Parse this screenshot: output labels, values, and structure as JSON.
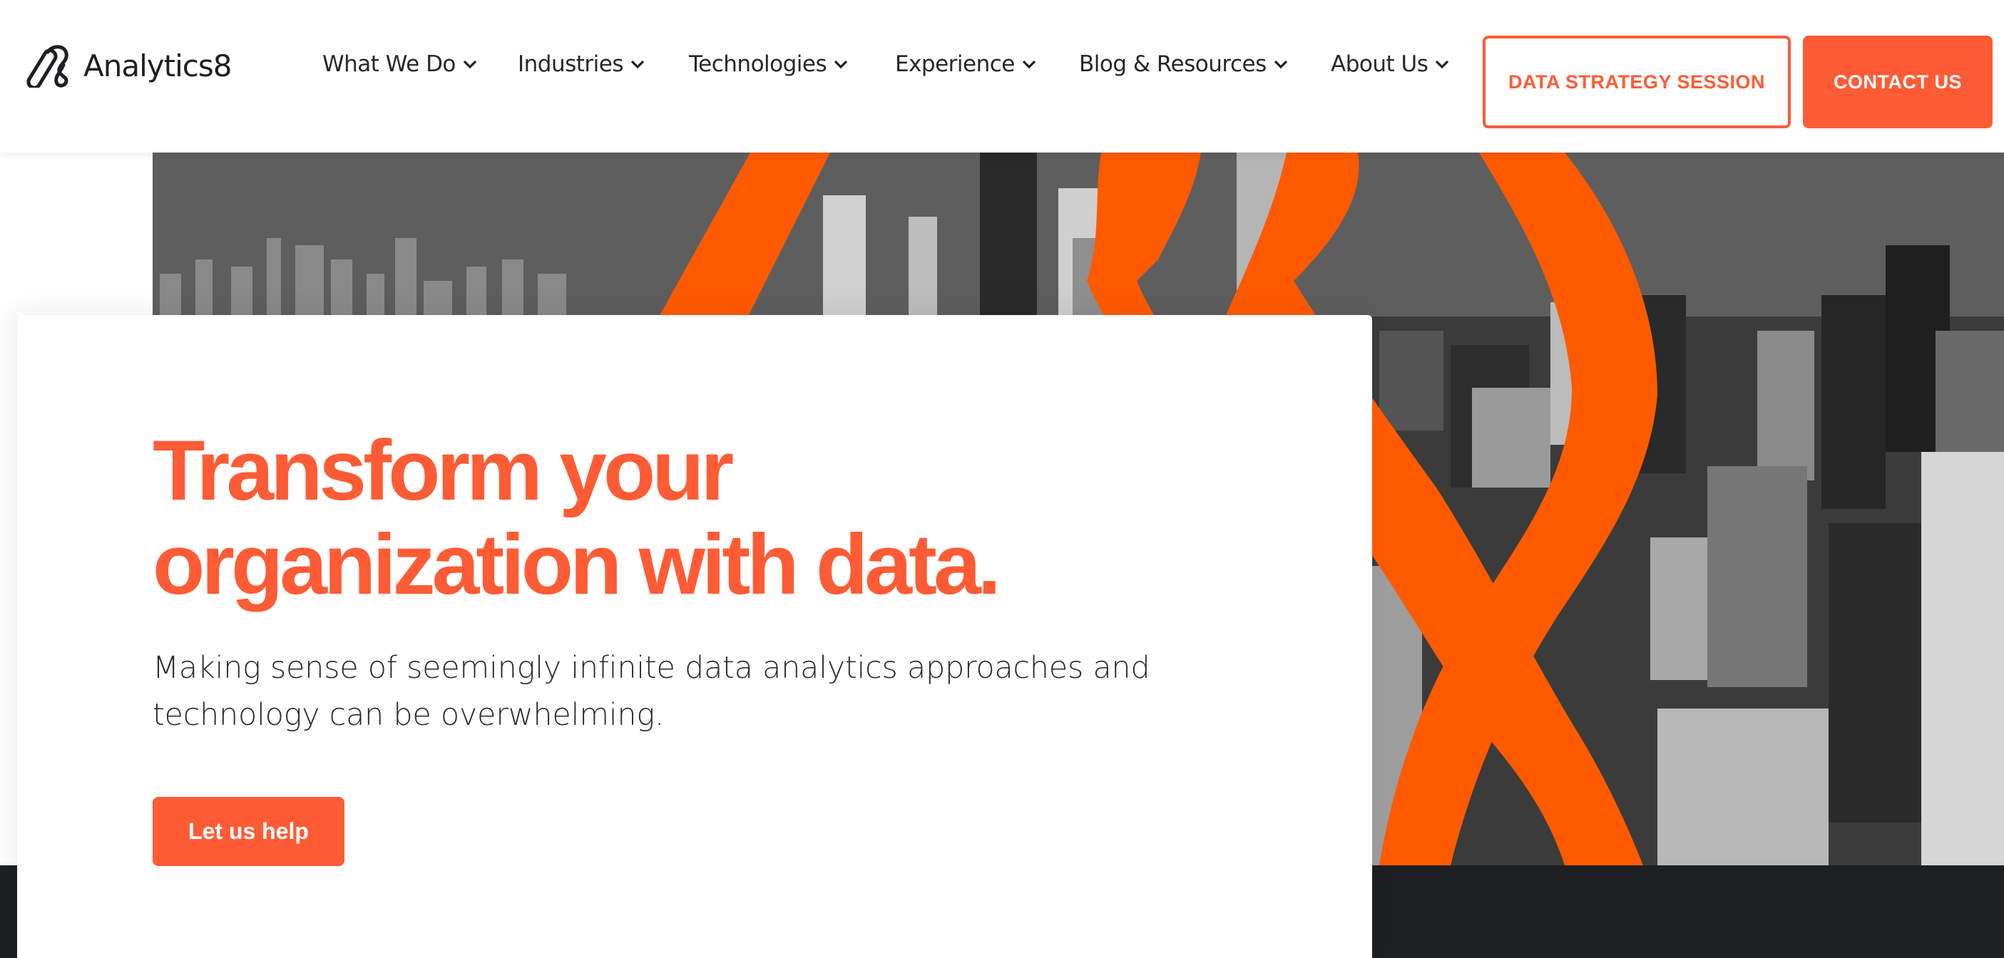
{
  "brand": {
    "name": "Analytics8",
    "logo_icon": "analytics8-logo-icon",
    "accent_color": "#ff5b35",
    "graphic_orange": "#ff5a00",
    "dark_color": "#1e1f23"
  },
  "nav": {
    "items": [
      {
        "label": "What We Do",
        "icon": "chevron-down-icon"
      },
      {
        "label": "Industries",
        "icon": "chevron-down-icon"
      },
      {
        "label": "Technologies",
        "icon": "chevron-down-icon"
      },
      {
        "label": "Experience",
        "icon": "chevron-down-icon"
      },
      {
        "label": "Blog & Resources",
        "icon": "chevron-down-icon"
      },
      {
        "label": "About Us",
        "icon": "chevron-down-icon"
      }
    ],
    "buttons": {
      "strategy_session": "DATA STRATEGY SESSION",
      "contact": "CONTACT US"
    }
  },
  "hero": {
    "headline_line1": "Transform your",
    "headline_line2": "organization with data.",
    "subtext": "Making sense of seemingly infinite data analytics approaches and technology can be overwhelming.",
    "cta_label": "Let us help",
    "image_description": "Black-and-white aerial city skyline with orange loop graphic"
  }
}
